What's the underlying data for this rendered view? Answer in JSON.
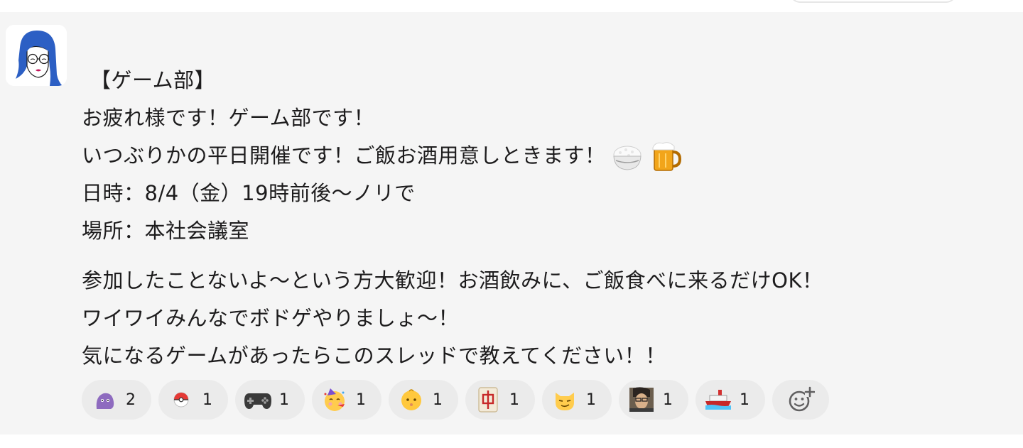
{
  "message": {
    "lines": [
      "【ゲーム部】",
      "お疲れ様です！ゲーム部です！",
      "いつぶりかの平日開催です！ご飯お酒用意しときます！",
      "日時：8/4（金）19時前後〜ノリで",
      "場所：本社会議室",
      "参加したことないよ〜という方大歓迎！お酒飲みに、ご飯食べに来るだけOK！",
      "ワイワイみんなでボドゲやりましょ〜！",
      "気になるゲームがあったらこのスレッドで教えてください！！"
    ],
    "inline_emojis": [
      "rice-bowl-icon",
      "beer-mug-icon"
    ]
  },
  "reactions": [
    {
      "icon": "purple-blob-icon",
      "count": "2"
    },
    {
      "icon": "poke-ball-icon",
      "count": "1"
    },
    {
      "icon": "game-controller-icon",
      "count": "1"
    },
    {
      "icon": "partying-face-icon",
      "count": "1"
    },
    {
      "icon": "baby-face-icon",
      "count": "1"
    },
    {
      "icon": "mahjong-tile-icon",
      "count": "1"
    },
    {
      "icon": "smirking-cat-icon",
      "count": "1"
    },
    {
      "icon": "person-photo-icon",
      "count": "1"
    },
    {
      "icon": "ship-icon",
      "count": "1"
    }
  ],
  "add_reaction": {
    "icon": "add-reaction-icon"
  },
  "colors": {
    "message_background": "#f5f5f5",
    "reaction_background": "#ebebeb",
    "text": "#1d1c1d"
  }
}
